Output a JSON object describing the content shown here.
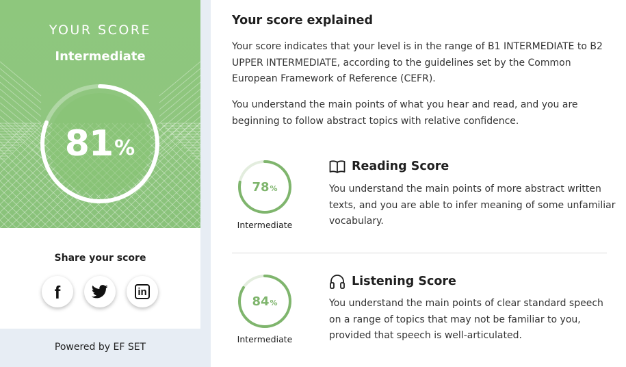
{
  "score_card": {
    "heading": "YOUR SCORE",
    "level": "Intermediate",
    "score": "81",
    "score_suffix": "%",
    "progress": 0.81,
    "colors": {
      "card": "#8fc67f",
      "ring": "#ffffff"
    }
  },
  "share": {
    "title": "Share your score",
    "buttons": [
      {
        "name": "facebook",
        "icon": "facebook-icon"
      },
      {
        "name": "twitter",
        "icon": "twitter-icon"
      },
      {
        "name": "linkedin",
        "icon": "linkedin-icon"
      }
    ]
  },
  "footer": {
    "powered_by": "Powered by EF SET"
  },
  "explanation": {
    "title": "Your score explained",
    "paragraphs": [
      "Your score indicates that your level is in the range of B1 INTERMEDIATE to B2 UPPER INTERMEDIATE, according to the guidelines set by the Common European Framework of Reference (CEFR).",
      "You understand the main points of what you hear and read, and you are beginning to follow abstract topics with relative confidence."
    ]
  },
  "sections": [
    {
      "title": "Reading Score",
      "icon": "book-icon",
      "score": "78",
      "score_suffix": "%",
      "progress": 0.78,
      "level": "Intermediate",
      "description": "You understand the main points of more abstract written texts, and you are able to infer meaning of some unfamiliar vocabulary."
    },
    {
      "title": "Listening Score",
      "icon": "headphones-icon",
      "score": "84",
      "score_suffix": "%",
      "progress": 0.84,
      "level": "Intermediate",
      "description": "You understand the main points of clear standard speech on a range of topics that may not be familiar to you, provided that speech is well-articulated."
    }
  ],
  "accent_color": "#7fb56d"
}
